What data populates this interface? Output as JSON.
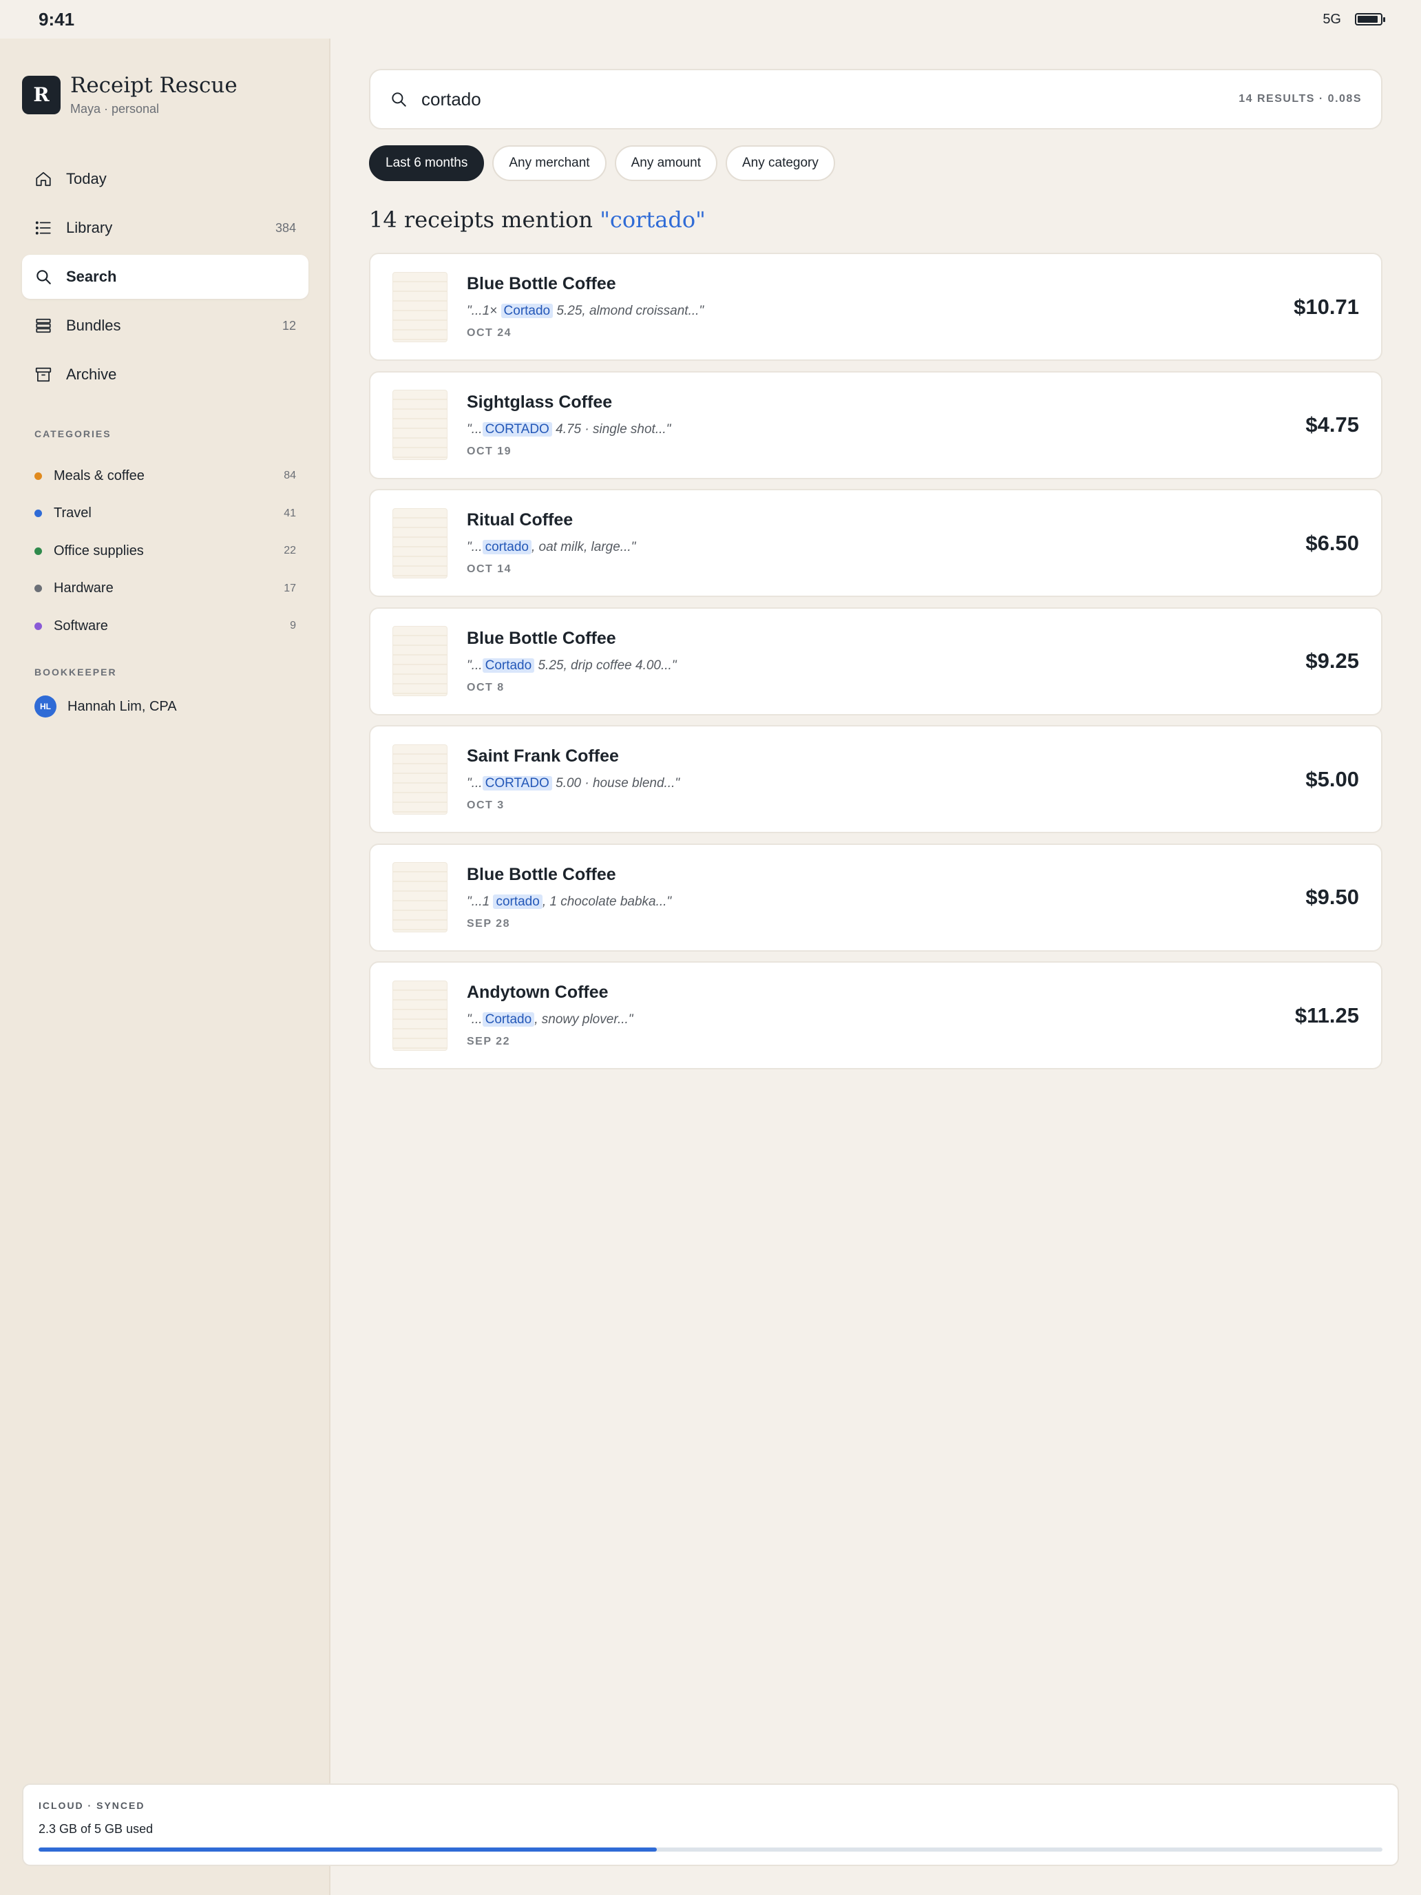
{
  "status": {
    "time": "9:41",
    "signal": "5G",
    "battery_level": 0.9
  },
  "app": {
    "name": "Receipt Rescue",
    "logo_letter": "R",
    "subtitle": "Maya · personal"
  },
  "nav": [
    {
      "label": "Today",
      "count": "",
      "icon": "home-icon"
    },
    {
      "label": "Library",
      "count": "384",
      "icon": "list-icon"
    },
    {
      "label": "Search",
      "count": "",
      "icon": "search-icon"
    },
    {
      "label": "Bundles",
      "count": "12",
      "icon": "stack-icon"
    },
    {
      "label": "Archive",
      "count": "",
      "icon": "archive-icon"
    }
  ],
  "categories_title": "CATEGORIES",
  "categories": [
    {
      "label": "Meals & coffee",
      "count": "84",
      "color": "#e08a1e"
    },
    {
      "label": "Travel",
      "count": "41",
      "color": "#2f6bd6"
    },
    {
      "label": "Office supplies",
      "count": "22",
      "color": "#2f8a4c"
    },
    {
      "label": "Hardware",
      "count": "17",
      "color": "#6b6f76"
    },
    {
      "label": "Software",
      "count": "9",
      "color": "#8a5ad6"
    }
  ],
  "bookkeeper_title": "BOOKKEEPER",
  "bookkeeper": {
    "initials": "HL",
    "name": "Hannah Lim, CPA"
  },
  "storage": {
    "title": "ICLOUD · SYNCED",
    "text": "2.3 GB of 5 GB used",
    "fraction": 0.46
  },
  "search": {
    "value": "cortado",
    "meta": "14 RESULTS · 0.08S"
  },
  "filters": [
    {
      "label": "Last 6 months",
      "active": true
    },
    {
      "label": "Any merchant",
      "active": false
    },
    {
      "label": "Any amount",
      "active": false
    },
    {
      "label": "Any category",
      "active": false
    }
  ],
  "results_title": {
    "prefix": "14 receipts mention ",
    "query": "\"cortado\""
  },
  "results": [
    {
      "merchant": "Blue Bottle Coffee",
      "pre": "\"...1× ",
      "match": "Cortado",
      "post": " 5.25, almond croissant...\"",
      "date": "OCT 24",
      "amount": "$10.71"
    },
    {
      "merchant": "Sightglass Coffee",
      "pre": "\"...",
      "match": "CORTADO",
      "post": " 4.75 · single shot...\"",
      "date": "OCT 19",
      "amount": "$4.75"
    },
    {
      "merchant": "Ritual Coffee",
      "pre": "\"...",
      "match": "cortado",
      "post": ", oat milk, large...\"",
      "date": "OCT 14",
      "amount": "$6.50"
    },
    {
      "merchant": "Blue Bottle Coffee",
      "pre": "\"...",
      "match": "Cortado",
      "post": " 5.25, drip coffee 4.00...\"",
      "date": "OCT 8",
      "amount": "$9.25"
    },
    {
      "merchant": "Saint Frank Coffee",
      "pre": "\"...",
      "match": "CORTADO",
      "post": " 5.00 · house blend...\"",
      "date": "OCT 3",
      "amount": "$5.00"
    },
    {
      "merchant": "Blue Bottle Coffee",
      "pre": "\"...1 ",
      "match": "cortado",
      "post": ", 1 chocolate babka...\"",
      "date": "SEP 28",
      "amount": "$9.50"
    },
    {
      "merchant": "Andytown Coffee",
      "pre": "\"...",
      "match": "Cortado",
      "post": ", snowy plover...\"",
      "date": "SEP 22",
      "amount": "$11.25"
    }
  ]
}
